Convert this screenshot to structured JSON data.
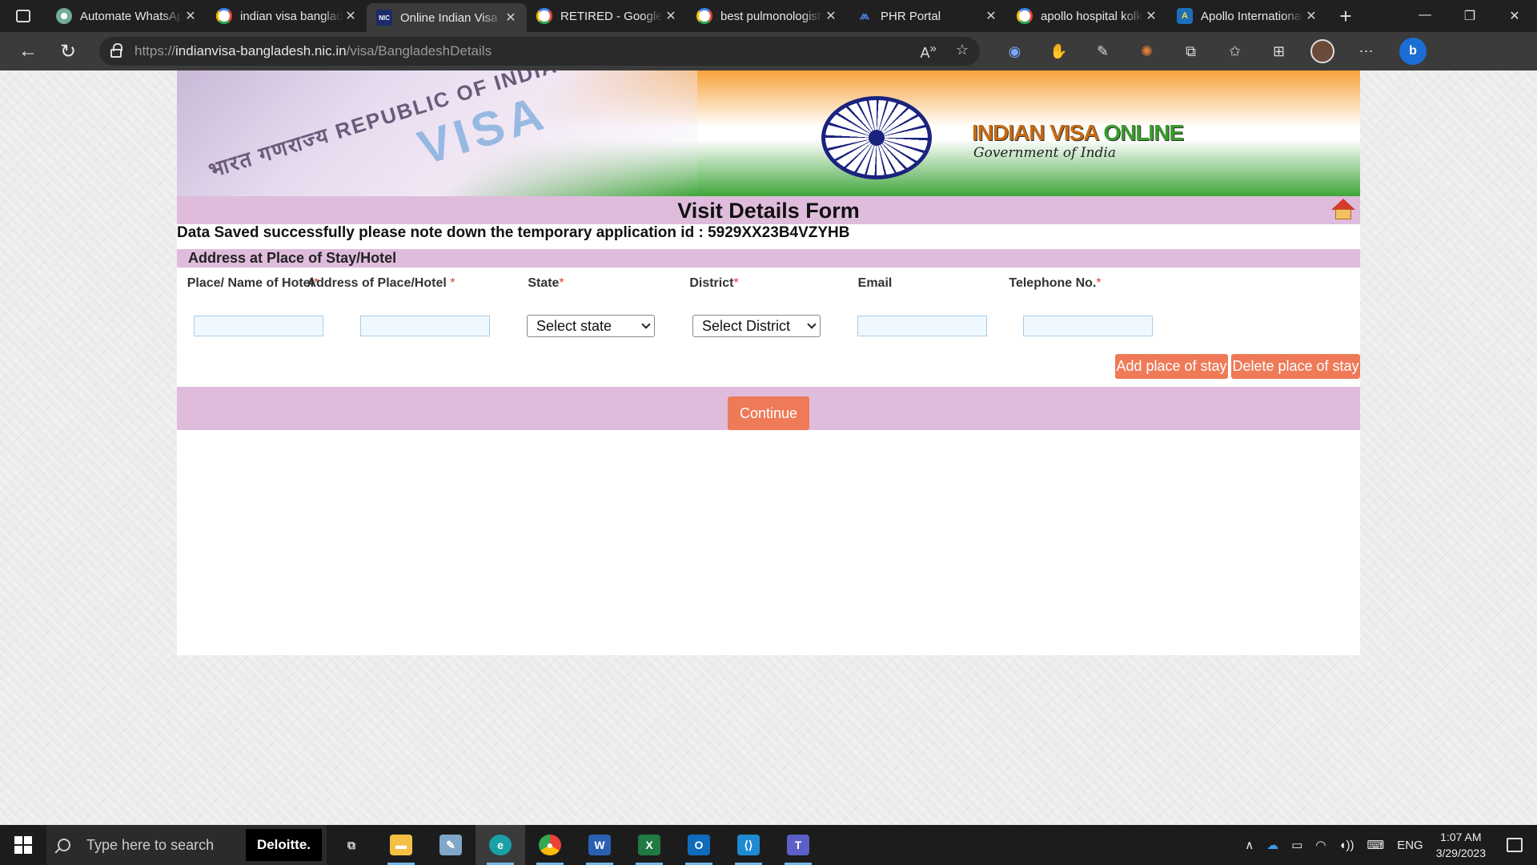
{
  "browser": {
    "tabs": [
      {
        "title": "Automate WhatsApp",
        "favicon": "chatgpt-icon",
        "active": false
      },
      {
        "title": "indian visa bangladesh",
        "favicon": "google-icon",
        "active": false
      },
      {
        "title": "Online Indian Visa",
        "favicon": "nic-icon",
        "active": true
      },
      {
        "title": "RETIRED - Google",
        "favicon": "google-icon",
        "active": false
      },
      {
        "title": "best pulmonologist",
        "favicon": "google-icon",
        "active": false
      },
      {
        "title": "PHR Portal",
        "favicon": "phr-icon",
        "active": false
      },
      {
        "title": "apollo hospital kolkata",
        "favicon": "google-icon",
        "active": false
      },
      {
        "title": "Apollo International",
        "favicon": "apollo-icon",
        "active": false
      }
    ],
    "url_scheme": "https://",
    "url_host": "indianvisa-bangladesh.nic.in",
    "url_path": "/visa/BangladeshDetails"
  },
  "page": {
    "banner": {
      "passport_text": "भारत गणराज्य REPUBLIC OF INDIA",
      "visa_text": "VISA",
      "brand_part1": "INDIAN VISA ",
      "brand_part2": "ONLINE",
      "subtitle": "Government of India"
    },
    "form_title": "Visit Details Form",
    "success_message": "Data Saved successfully please note down the temporary application id : 5929XX23B4VZYHB",
    "section_title": "Address at Place of Stay/Hotel",
    "columns": {
      "hotel_name": "Place/ Name of Hotel",
      "address": "Address of Place/Hotel",
      "state": "State",
      "district": "District",
      "email": "Email",
      "telephone": "Telephone No."
    },
    "required_mark": "*",
    "fields": {
      "hotel_name_value": "",
      "address_value": "",
      "state_selected": "Select state",
      "district_selected": "Select District",
      "email_value": "",
      "telephone_value": ""
    },
    "buttons": {
      "add_place": "Add place of stay",
      "delete_place": "Delete place of stay",
      "continue": "Continue"
    },
    "colors": {
      "accent_bar": "#dfbcdc",
      "button": "#ee7a58",
      "required": "#e03a2a"
    }
  },
  "taskbar": {
    "search_placeholder": "Type here to search",
    "search_badge": "Deloitte.",
    "language": "ENG",
    "time": "1:07 AM",
    "date": "3/29/2023"
  }
}
